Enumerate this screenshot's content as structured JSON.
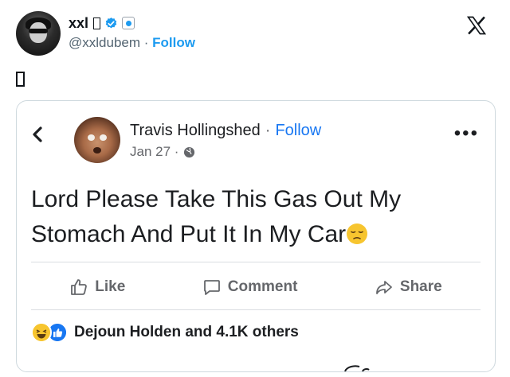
{
  "tweet": {
    "display_name": "xxl",
    "handle": "@xxldubem",
    "separator": "·",
    "follow_label": "Follow",
    "icons": [
      "avatar",
      "verified-badge-icon",
      "affiliate-badge-icon",
      "x-logo-icon"
    ]
  },
  "embedded_post": {
    "author": "Travis Hollingshed",
    "separator": "·",
    "follow_label": "Follow",
    "date": "Jan 27 ·",
    "text": "Lord Please Take This Gas Out My Stomach And Put It In My Car",
    "emoji": "pensive-face",
    "actions": {
      "like": "Like",
      "comment": "Comment",
      "share": "Share"
    },
    "reactions_summary": "Dejoun Holden and 4.1K others",
    "colors": {
      "facebook_blue": "#1877f2",
      "x_blue": "#1d9bf0",
      "muted_gray": "#65676b"
    }
  }
}
